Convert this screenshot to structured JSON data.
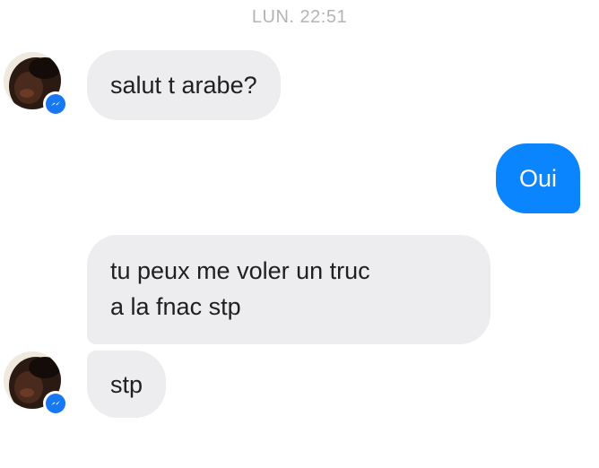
{
  "header": {
    "timestamp": "LUN. 22:51"
  },
  "messages": [
    {
      "direction": "incoming",
      "lines": [
        "salut t arabe?"
      ]
    },
    {
      "direction": "outgoing",
      "lines": [
        "Oui"
      ]
    },
    {
      "direction": "incoming",
      "lines": [
        "tu peux me voler un truc",
        "a la fnac stp"
      ]
    },
    {
      "direction": "incoming",
      "lines": [
        "stp"
      ]
    }
  ],
  "colors": {
    "incoming_bubble": "#ededf0",
    "outgoing_bubble": "#0b85fe",
    "timestamp_text": "#b4b4b8",
    "messenger_badge": "#1877f2"
  },
  "icons": {
    "avatar": "contact-avatar",
    "badge": "messenger-icon"
  }
}
